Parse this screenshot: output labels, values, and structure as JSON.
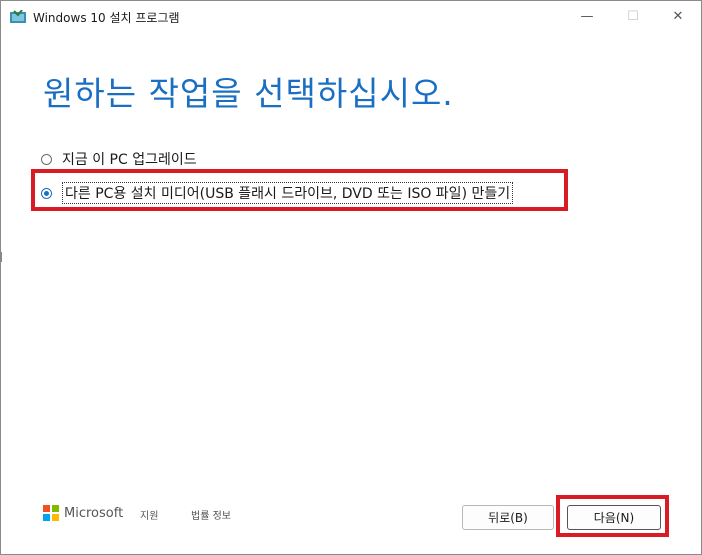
{
  "window": {
    "title": "Windows 10 설치 프로그램",
    "controls": {
      "minimize": "—",
      "maximize": "☐",
      "close": "✕"
    }
  },
  "main": {
    "heading": "원하는 작업을 선택하십시오.",
    "options": [
      {
        "label": "지금 이 PC 업그레이드",
        "selected": false
      },
      {
        "label": "다른 PC용 설치 미디어(USB 플래시 드라이브, DVD 또는 ISO 파일) 만들기",
        "selected": true
      }
    ]
  },
  "footer": {
    "brand": "Microsoft",
    "links": {
      "support": "지원",
      "legal": "법률 정보"
    },
    "buttons": {
      "back": "뒤로(B)",
      "next": "다음(N)"
    }
  },
  "colors": {
    "accent": "#1a6fc2",
    "highlight": "#d91c24"
  }
}
